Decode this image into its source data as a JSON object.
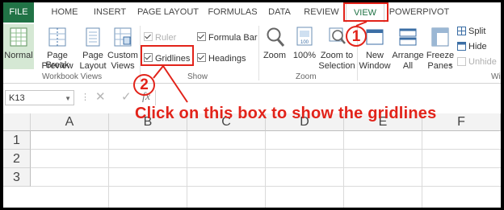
{
  "tabs": [
    {
      "label": "FILE"
    },
    {
      "label": "HOME"
    },
    {
      "label": "INSERT"
    },
    {
      "label": "PAGE LAYOUT"
    },
    {
      "label": "FORMULAS"
    },
    {
      "label": "DATA"
    },
    {
      "label": "REVIEW"
    },
    {
      "label": "VIEW"
    },
    {
      "label": "POWERPIVOT"
    }
  ],
  "ribbon": {
    "workbook_views": {
      "label": "Workbook Views",
      "normal": "Normal",
      "page_break_1": "Page Break",
      "page_break_2": "Preview",
      "page_layout_1": "Page",
      "page_layout_2": "Layout",
      "custom_views_1": "Custom",
      "custom_views_2": "Views"
    },
    "show": {
      "label": "Show",
      "ruler": "Ruler",
      "formula_bar": "Formula Bar",
      "gridlines": "Gridlines",
      "headings": "Headings"
    },
    "zoom": {
      "label": "Zoom",
      "zoom": "Zoom",
      "hundred": "100%",
      "zoom_sel_1": "Zoom to",
      "zoom_sel_2": "Selection"
    },
    "window": {
      "label": "Wi",
      "new_window_1": "New",
      "new_window_2": "Window",
      "arrange_1": "Arrange",
      "arrange_2": "All",
      "freeze_1": "Freeze",
      "freeze_2": "Panes",
      "split": "Split",
      "hide": "Hide",
      "unhide": "Unhide"
    }
  },
  "formula_bar": {
    "name_box": "K13",
    "fx": "fx"
  },
  "grid": {
    "columns": [
      "A",
      "B",
      "C",
      "D",
      "E",
      "F"
    ],
    "rows": [
      "1",
      "2",
      "3"
    ]
  },
  "annotations": {
    "step1": "1",
    "step2": "2",
    "callout": "Click on this box to show the gridlines"
  },
  "colors": {
    "excel_green": "#217346",
    "annotation_red": "#e2231a"
  }
}
